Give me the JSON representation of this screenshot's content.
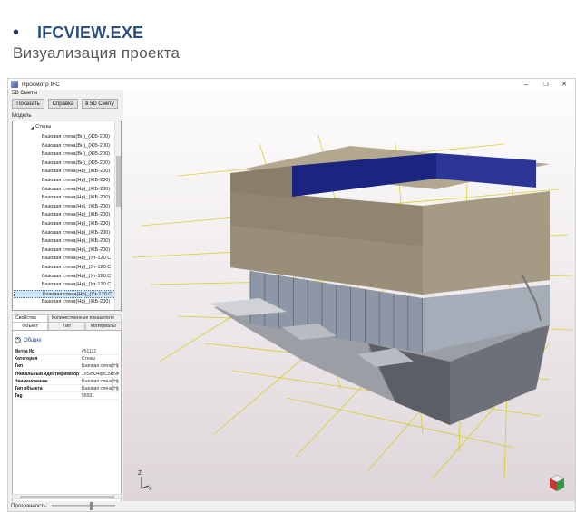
{
  "slide": {
    "bullet": "•",
    "heading": "IFCVIEW.EXE",
    "subtitle": "Визуализация проекта"
  },
  "window": {
    "title": "Просмотр IFC",
    "minimize": "–",
    "maximize": "❐",
    "close": "✕"
  },
  "left_panel": {
    "estimate_label": "5D Сметы",
    "buttons": [
      "Показать",
      "Справка",
      "в 5D Смету"
    ],
    "model_label": "Модель",
    "tree": {
      "expander": "◢",
      "root": "Стены",
      "selected_index": 18,
      "items": [
        "Базовая стена(Вн)_(ЖБ-200)",
        "Базовая стена(Вн)_(ЖБ-200)",
        "Базовая стена(Вн)_(ЖБ-200)",
        "Базовая стена(Вн)_(ЖБ-200)",
        "Базовая стена(Нр)_(ЖБ-200)",
        "Базовая стена(Нр)_(ЖБ-200)",
        "Базовая стена(Нр)_(ЖБ-200)",
        "Базовая стена(Нр)_(ЖБ-200)",
        "Базовая стена(Нр)_(ЖБ-200)",
        "Базовая стена(Нр)_(ЖБ-200)",
        "Базовая стена(Нр)_(ЖБ-200)",
        "Базовая стена(Нр)_(ЖБ-200)",
        "Базовая стена(Нр)_(ЖБ-200)",
        "Базовая стена(Нр)_(ЖБ-200)",
        "Базовая стена(Нр)_(Ут-120.С",
        "Базовая стена(Нр)_(Ут-120.С",
        "Базовая стена(Нр)_(Ут-120.С",
        "Базовая стена(Нр)_(Ут-120.С",
        "Базовая стена(Нр)_(Ут-170.С",
        "Базовая стена(Нр)_(ЖБ-200)"
      ]
    },
    "tabs_top": [
      "Свойства",
      "Количественные показатели"
    ],
    "tabs_bottom": [
      "Объект",
      "Тип",
      "Материалы"
    ],
    "group_icon": "^",
    "group_title": "Общие",
    "properties": [
      {
        "key": "Метка Ifc",
        "value": "#51121"
      },
      {
        "key": "Категория",
        "value": "Стены"
      },
      {
        "key": "Тип",
        "value": "Базовая стена(Нр)"
      },
      {
        "key": "Уникальный идентификатор",
        "value": "1nSmO4qbC5RNK"
      },
      {
        "key": "Наименование",
        "value": "Базовая стена(Нр)"
      },
      {
        "key": "Тип объекта",
        "value": "Базовая стена(Нр)"
      },
      {
        "key": "Tag",
        "value": "55591"
      }
    ]
  },
  "status": {
    "transparency_label": "Прозрачность:",
    "transparency_level": 0.63
  },
  "viewport": {
    "axis_z": "Z",
    "axis_x": "X",
    "colors": {
      "background_top": "#fdfcfc",
      "background_bottom": "#ddd5d9",
      "wall": "#8f8570",
      "roof": "#1a2580",
      "glass": "#8e97a6",
      "slab": "#9c9ea5",
      "grid": "#d4c800"
    },
    "cube_icon": "view-cube-icon"
  }
}
